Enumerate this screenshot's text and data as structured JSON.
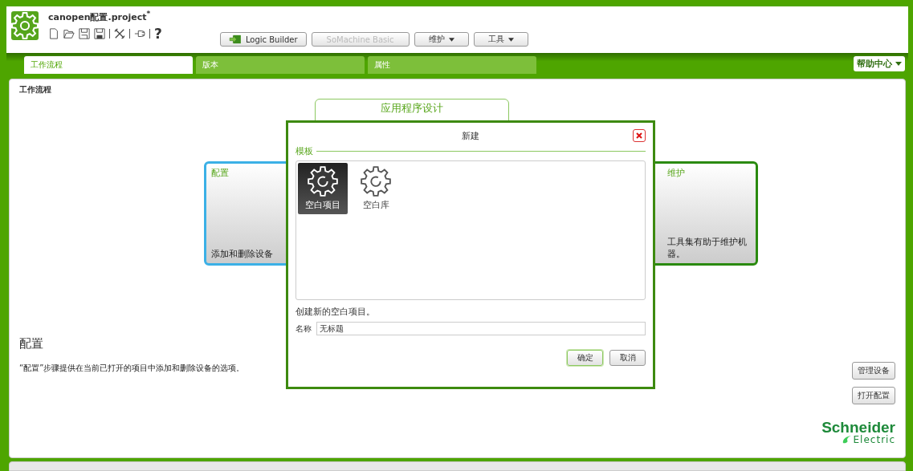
{
  "app": {
    "title": "canopen配置.project",
    "modified_mark": "*"
  },
  "toolbar": {
    "help_glyph": "?"
  },
  "mode_buttons": [
    {
      "label": "Logic Builder",
      "kind": "launch",
      "disabled": false
    },
    {
      "label": "SoMachine Basic",
      "kind": "plain",
      "disabled": true
    },
    {
      "label": "维护",
      "kind": "dropdown",
      "disabled": false
    },
    {
      "label": "工具",
      "kind": "dropdown",
      "disabled": false
    }
  ],
  "tabs": [
    {
      "label": "工作流程",
      "selected": true
    },
    {
      "label": "版本",
      "selected": false
    },
    {
      "label": "属性",
      "selected": false
    }
  ],
  "help_center": {
    "label": "帮助中心"
  },
  "workflow": {
    "heading": "工作流程",
    "steps": [
      {
        "title": "配置",
        "description": "添加和删除设备",
        "kind": "config",
        "selected": true
      },
      {
        "title": "应用程序设计",
        "kind": "design",
        "selected": false
      },
      {
        "title": "维护",
        "description": "工具集有助于维护机器。",
        "kind": "maintain",
        "selected": false
      }
    ]
  },
  "detail": {
    "title": "配置",
    "description": "“配置”步骤提供在当前已打开的项目中添加和删除设备的选项。"
  },
  "actions": [
    {
      "label": "管理设备"
    },
    {
      "label": "打开配置"
    }
  ],
  "brand": {
    "name": "Schneider",
    "sub": "Electric"
  },
  "dialog": {
    "title": "新建",
    "group_label": "模板",
    "templates": [
      {
        "label": "空白项目",
        "selected": true
      },
      {
        "label": "空白库",
        "selected": false
      }
    ],
    "description": "创建新的空白项目。",
    "name_label": "名称",
    "name_value": "无标题",
    "buttons": [
      {
        "label": "确定",
        "kind": "primary"
      },
      {
        "label": "取消",
        "kind": "secondary"
      }
    ]
  }
}
